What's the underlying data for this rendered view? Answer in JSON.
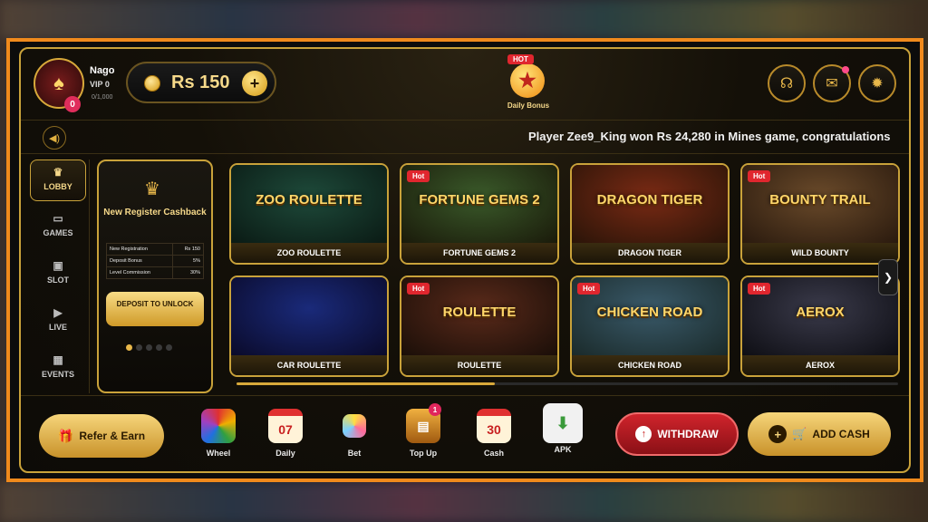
{
  "user": {
    "name": "Nago",
    "vip": "VIP 0",
    "vip_progress": "0/1,000",
    "notifications": "0"
  },
  "wallet": {
    "balance": "Rs 150",
    "add_label": "+"
  },
  "daily_bonus": {
    "badge": "HOT",
    "label": "Daily Bonus"
  },
  "header_icons": [
    "headset-icon",
    "mail-icon",
    "settings-icon"
  ],
  "ticker": {
    "text": "Player Zee9_King won Rs 24,280 in Mines game, congratulations"
  },
  "sidebar": {
    "items": [
      {
        "label": "LOBBY",
        "icon": "crown-icon",
        "active": true
      },
      {
        "label": "GAMES",
        "icon": "gamepad-icon"
      },
      {
        "label": "SLOT",
        "icon": "slot-icon"
      },
      {
        "label": "LIVE",
        "icon": "play-icon"
      },
      {
        "label": "EVENTS",
        "icon": "calendar-icon"
      }
    ]
  },
  "promo": {
    "title": "New Register Cashback",
    "rows": [
      {
        "label": "New Registration",
        "value": "Rs 150"
      },
      {
        "label": "Deposit Bonus",
        "value": "5%"
      },
      {
        "label": "Level Commission",
        "value": "30%"
      }
    ],
    "button": "DEPOSIT TO UNLOCK",
    "slides": 5,
    "active_slide": 0
  },
  "games": [
    {
      "title": "ZOO ROULETTE",
      "art_text": "ZOO ROULETTE",
      "hot": "",
      "colors": [
        "#1e4a3a",
        "#0a1a14"
      ]
    },
    {
      "title": "FORTUNE GEMS 2",
      "art_text": "FORTUNE GEMS 2",
      "hot": "Hot",
      "colors": [
        "#3a5a2a",
        "#1a1a0a"
      ]
    },
    {
      "title": "DRAGON TIGER",
      "art_text": "DRAGON TIGER",
      "hot": "",
      "colors": [
        "#7a2a14",
        "#2a1408"
      ]
    },
    {
      "title": "WILD BOUNTY",
      "art_text": "BOUNTY TRAIL",
      "hot": "Hot",
      "colors": [
        "#6a4a2a",
        "#2a1a0e"
      ]
    },
    {
      "title": "CAR ROULETTE",
      "art_text": "",
      "hot": "",
      "colors": [
        "#1a2a7a",
        "#0a0a2a"
      ]
    },
    {
      "title": "ROULETTE",
      "art_text": "ROULETTE",
      "hot": "Hot",
      "colors": [
        "#5a2a1a",
        "#1a0e08"
      ]
    },
    {
      "title": "CHICKEN ROAD",
      "art_text": "CHICKEN ROAD",
      "hot": "Hot",
      "colors": [
        "#3a5a6a",
        "#1a2a2a"
      ]
    },
    {
      "title": "AEROX",
      "art_text": "AEROX",
      "hot": "Hot",
      "colors": [
        "#3a3a4a",
        "#0e0e14"
      ]
    }
  ],
  "bottom": {
    "refer": "Refer & Earn",
    "tools": [
      {
        "label": "Wheel",
        "icon": "wheel-icon"
      },
      {
        "label": "Daily",
        "icon": "calendar-07-icon",
        "value": "07"
      },
      {
        "label": "Bet",
        "icon": "bet-icon"
      },
      {
        "label": "Top Up",
        "icon": "chest-icon",
        "badge": "1"
      },
      {
        "label": "Cash",
        "icon": "calendar-30-icon",
        "value": "30"
      },
      {
        "label": "APK",
        "icon": "download-icon"
      }
    ],
    "withdraw": "WITHDRAW",
    "add_cash": "ADD CASH"
  },
  "colors": {
    "accent": "#c9a23a",
    "frame": "#f08a1c",
    "hot": "#e0262e",
    "withdraw": "#d0242c"
  }
}
